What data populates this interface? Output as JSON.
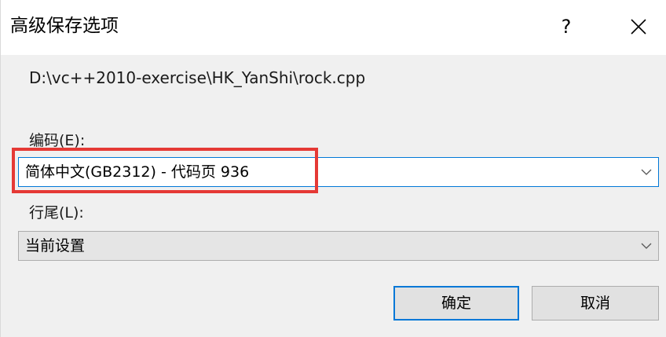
{
  "dialog": {
    "title": "高级保存选项",
    "help_glyph": "?",
    "file_path": "D:\\vc++2010-exercise\\HK_YanShi\\rock.cpp"
  },
  "encoding": {
    "label": "编码(E):",
    "value": "简体中文(GB2312) - 代码页 936"
  },
  "line_endings": {
    "label": "行尾(L):",
    "value": "当前设置"
  },
  "buttons": {
    "ok_label": "确定",
    "cancel_label": "取消"
  },
  "colors": {
    "highlight": "#e53935",
    "focus_accent": "#0078d7"
  },
  "icons": {
    "close": "close-icon",
    "dropdown": "chevron-down-icon"
  }
}
